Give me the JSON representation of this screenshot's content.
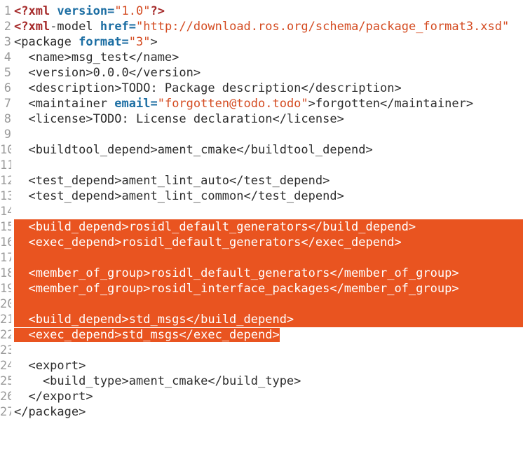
{
  "editor": {
    "lines": [
      {
        "num": "1",
        "code": ""
      },
      {
        "num": "2",
        "code": ""
      },
      {
        "num": "3",
        "code": "<package format=\"3\">"
      },
      {
        "num": "4",
        "code": "  <name>msg_test</name>"
      },
      {
        "num": "5",
        "code": "  <version>0.0.0</version>"
      },
      {
        "num": "6",
        "code": "  <description>TODO: Package description</description>"
      },
      {
        "num": "7",
        "code": ""
      },
      {
        "num": "8",
        "code": "  <license>TODO: License declaration</license>"
      },
      {
        "num": "9",
        "code": ""
      },
      {
        "num": "10",
        "code": "  <buildtool_depend>ament_cmake</buildtool_depend>"
      },
      {
        "num": "11",
        "code": ""
      },
      {
        "num": "12",
        "code": "  <test_depend>ament_lint_auto</test_depend>"
      },
      {
        "num": "13",
        "code": "  <test_depend>ament_lint_common</test_depend>"
      },
      {
        "num": "14",
        "code": ""
      },
      {
        "num": "15",
        "code": "  <build_depend>rosidl_default_generators</build_depend>"
      },
      {
        "num": "16",
        "code": "  <exec_depend>rosidl_default_generators</exec_depend>"
      },
      {
        "num": "17",
        "code": ""
      },
      {
        "num": "18",
        "code": "  <member_of_group>rosidl_default_generators</member_of_group>"
      },
      {
        "num": "19",
        "code": "  <member_of_group>rosidl_interface_packages</member_of_group>"
      },
      {
        "num": "20",
        "code": ""
      },
      {
        "num": "21",
        "code": "  <build_depend>std_msgs</build_depend>"
      },
      {
        "num": "22",
        "code": "  <exec_depend>std_msgs</exec_depend>"
      },
      {
        "num": "23",
        "code": ""
      },
      {
        "num": "24",
        "code": "  <export>"
      },
      {
        "num": "25",
        "code": "    <build_type>ament_cmake</build_type>"
      },
      {
        "num": "26",
        "code": "  </export>"
      },
      {
        "num": "27",
        "code": "</package>"
      }
    ],
    "line1": {
      "pi_open": "<?xml ",
      "attr": "version=",
      "val": "\"1.0\"",
      "pi_close": "?>"
    },
    "line2": {
      "pi_open": "<?xml",
      "mid": "-model ",
      "attr": "href=",
      "val": "\"http://download.ros.org/schema/package_format3.xsd\""
    },
    "line3": {
      "open": "<package ",
      "attr": "format=",
      "val": "\"3\"",
      "close": ">"
    },
    "line7": {
      "open": "  <maintainer ",
      "attr": "email=",
      "val": "\"forgotten@todo.todo\"",
      "rest": ">forgotten</maintainer>"
    },
    "colors": {
      "selection": "#e95420",
      "attribute": "#1c6ea3",
      "string": "#d44c22",
      "pi": "#a52a2a"
    }
  }
}
